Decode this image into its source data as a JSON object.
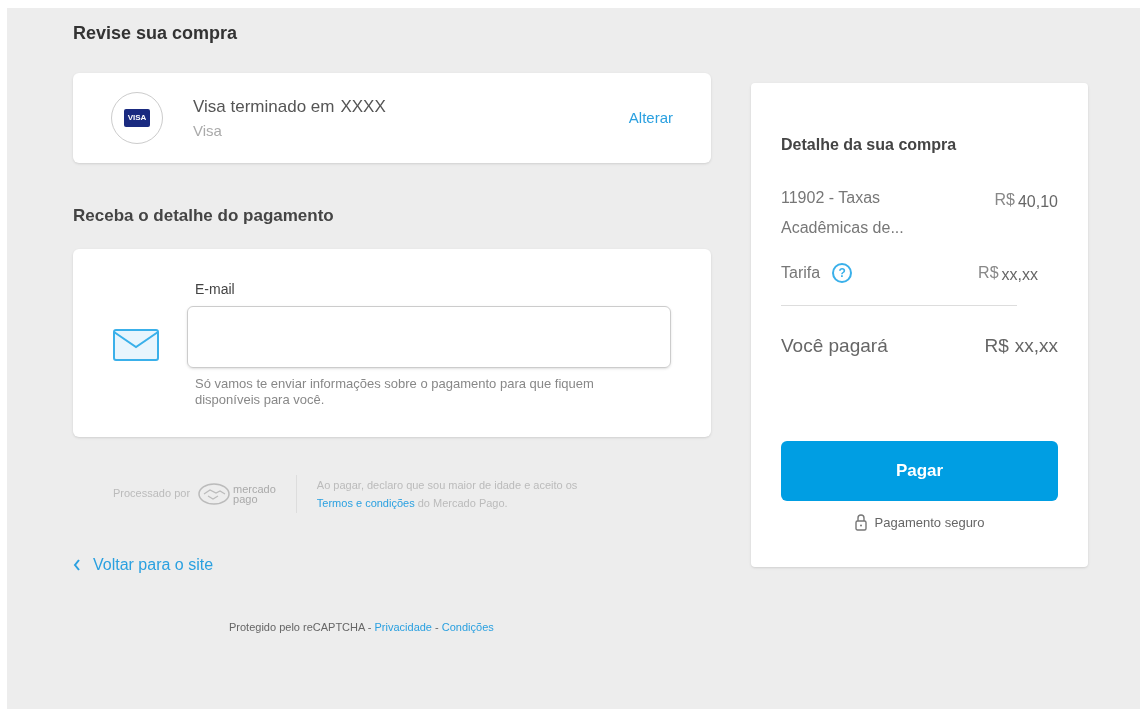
{
  "review": {
    "title": "Revise sua compra",
    "card": {
      "title": "Visa terminado em",
      "number": "XXXX",
      "brand": "Visa",
      "badge": "VISA",
      "action": "Alterar"
    }
  },
  "receipt": {
    "title": "Receba o detalhe do pagamento",
    "email_label": "E-mail",
    "hint": "Só vamos te enviar informações sobre o pagamento para que fiquem disponíveis para você."
  },
  "footer": {
    "processed_by": "Processado por",
    "logo_line1": "mercado",
    "logo_line2": "pago",
    "terms_before": "Ao pagar, declaro que sou maior de idade e aceito os",
    "terms_link": "Termos e condições",
    "terms_after": "do Mercado Pago."
  },
  "back_link": "Voltar para o site",
  "recaptcha": {
    "text": "Protegido pelo reCAPTCHA -",
    "privacy": "Privacidade",
    "separator": "-",
    "conditions": "Condições"
  },
  "summary": {
    "title": "Detalhe da sua compra",
    "items": [
      {
        "kind": "item",
        "label": "11902 - Taxas Acadêmicas de...",
        "currency": "R$",
        "amount": "40,10"
      },
      {
        "kind": "fee",
        "label": "Tarifa",
        "icon": "?",
        "currency": "R$",
        "amount": "xx,xx"
      }
    ],
    "total_label": "Você pagará",
    "total_currency": "R$",
    "total_amount": "xx,xx",
    "pay_button": "Pagar",
    "secure": "Pagamento seguro"
  }
}
